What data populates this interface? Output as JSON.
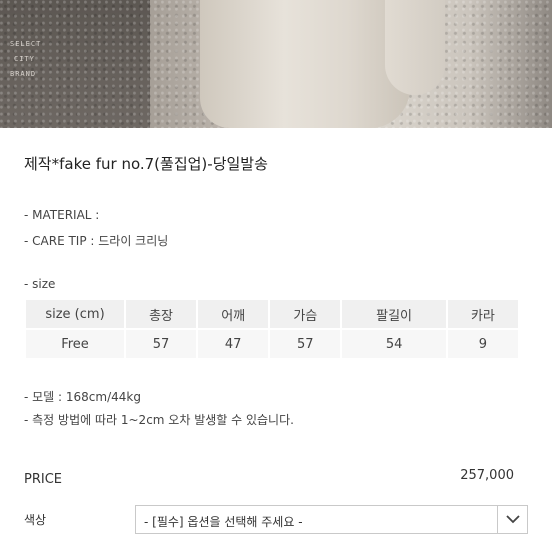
{
  "product": {
    "title": "제작*fake fur no.7(풀집업)-당일발송",
    "material": "- MATERIAL :",
    "care_tip": "- CARE TIP : 드라이 크리닝"
  },
  "size_section": {
    "label": "- size",
    "headers": [
      "size (cm)",
      "총장",
      "어깨",
      "가슴",
      "팔길이",
      "카라"
    ],
    "rows": [
      [
        "Free",
        "57",
        "47",
        "57",
        "54",
        "9"
      ]
    ]
  },
  "notes": {
    "model": "- 모델 : 168cm/44kg",
    "measure": "- 측정 방법에 따라 1~2cm 오차 발생할 수 있습니다."
  },
  "price": {
    "label": "PRICE",
    "value": "257,000"
  },
  "option": {
    "label": "색상",
    "placeholder": "- [필수] 옵션을 선택해 주세요 -"
  },
  "photo_labels": [
    "SELECT",
    "CITY",
    "BRAND"
  ]
}
